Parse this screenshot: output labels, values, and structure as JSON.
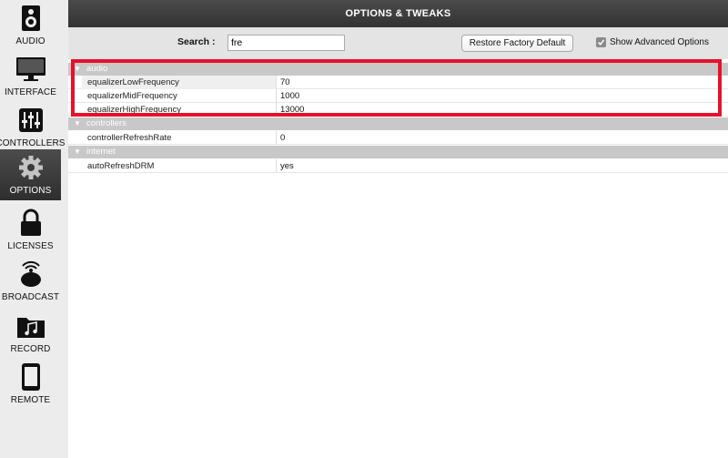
{
  "sidebar": {
    "items": [
      {
        "label": "AUDIO",
        "icon": "speaker-icon"
      },
      {
        "label": "INTERFACE",
        "icon": "monitor-icon"
      },
      {
        "label": "CONTROLLERS",
        "icon": "sliders-icon"
      },
      {
        "label": "OPTIONS",
        "icon": "gear-icon",
        "active": true
      },
      {
        "label": "LICENSES",
        "icon": "lock-icon"
      },
      {
        "label": "BROADCAST",
        "icon": "broadcast-icon"
      },
      {
        "label": "RECORD",
        "icon": "music-folder-icon"
      },
      {
        "label": "REMOTE",
        "icon": "phone-icon"
      }
    ]
  },
  "header": {
    "title": "OPTIONS & TWEAKS"
  },
  "toolbar": {
    "search_label": "Search :",
    "search_value": "fre",
    "restore_label": "Restore Factory Default",
    "show_advanced_label": "Show Advanced Options",
    "show_advanced_checked": true
  },
  "groups": [
    {
      "name": "audio",
      "rows": [
        {
          "key": "equalizerLowFrequency",
          "value": "70"
        },
        {
          "key": "equalizerMidFrequency",
          "value": "1000"
        },
        {
          "key": "equalizerHighFrequency",
          "value": "13000"
        }
      ]
    },
    {
      "name": "controllers",
      "rows": [
        {
          "key": "controllerRefreshRate",
          "value": "0"
        }
      ]
    },
    {
      "name": "internet",
      "rows": [
        {
          "key": "autoRefreshDRM",
          "value": "yes"
        }
      ]
    }
  ],
  "colors": {
    "header_bg": "#3d3d3d",
    "highlight": "#e8102a",
    "group_header": "#c8c8c8",
    "sidebar_active": "#3a3a3a"
  }
}
